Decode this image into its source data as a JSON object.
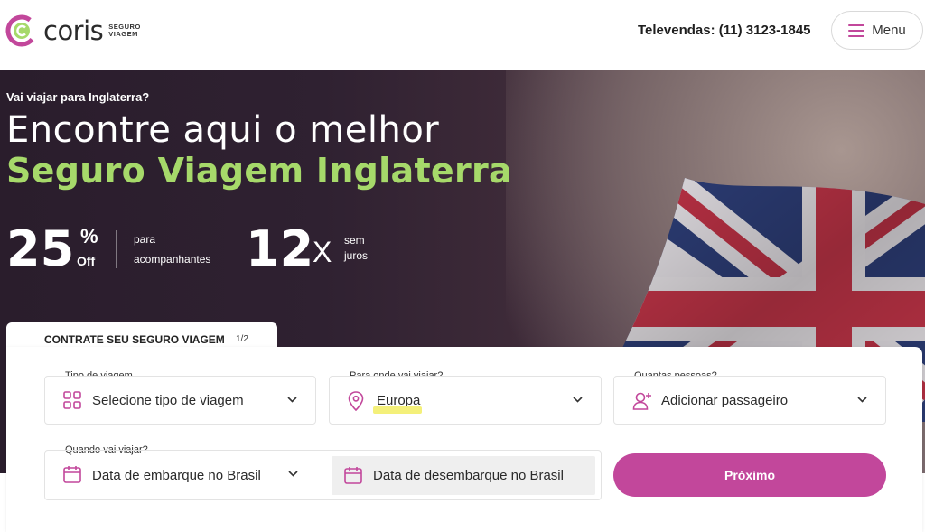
{
  "brand": {
    "name": "coris",
    "sub_line1": "SEGURO",
    "sub_line2": "VIAGEM"
  },
  "header": {
    "phone": "Televendas: (11) 3123-1845",
    "menu_label": "Menu"
  },
  "hero": {
    "kicker": "Vai viajar para Inglaterra?",
    "title_line1": "Encontre aqui o melhor",
    "title_line2": "Seguro Viagem Inglaterra",
    "promo1": {
      "number": "25",
      "unit": "%",
      "unit_sub": "Off",
      "desc_line1": "para",
      "desc_line2": "acompanhantes"
    },
    "promo2": {
      "number": "12",
      "unit": "X",
      "desc_line1": "sem",
      "desc_line2": "juros"
    }
  },
  "form": {
    "tab_title": "CONTRATE SEU SEGURO VIAGEM",
    "tab_step": "1/2",
    "trip_type": {
      "label": "Tipo de viagem",
      "value": "Selecione tipo de viagem"
    },
    "destination": {
      "label": "Para onde vai viajar?",
      "value": "Europa"
    },
    "travelers": {
      "label": "Quantas pessoas?",
      "value": "Adicionar passageiro"
    },
    "dates": {
      "label": "Quando vai viajar?",
      "departure": "Data de embarque no Brasil",
      "return": "Data de desembarque no Brasil"
    },
    "next_label": "Próximo"
  },
  "colors": {
    "accent": "#c2479b",
    "green": "#a6d96a",
    "hero_bg": "#2f2131",
    "icon_pink": "#c2479b"
  },
  "icons": [
    "menu-icon",
    "grid-icon",
    "location-pin-icon",
    "add-user-icon",
    "calendar-icon",
    "chevron-down-icon"
  ]
}
